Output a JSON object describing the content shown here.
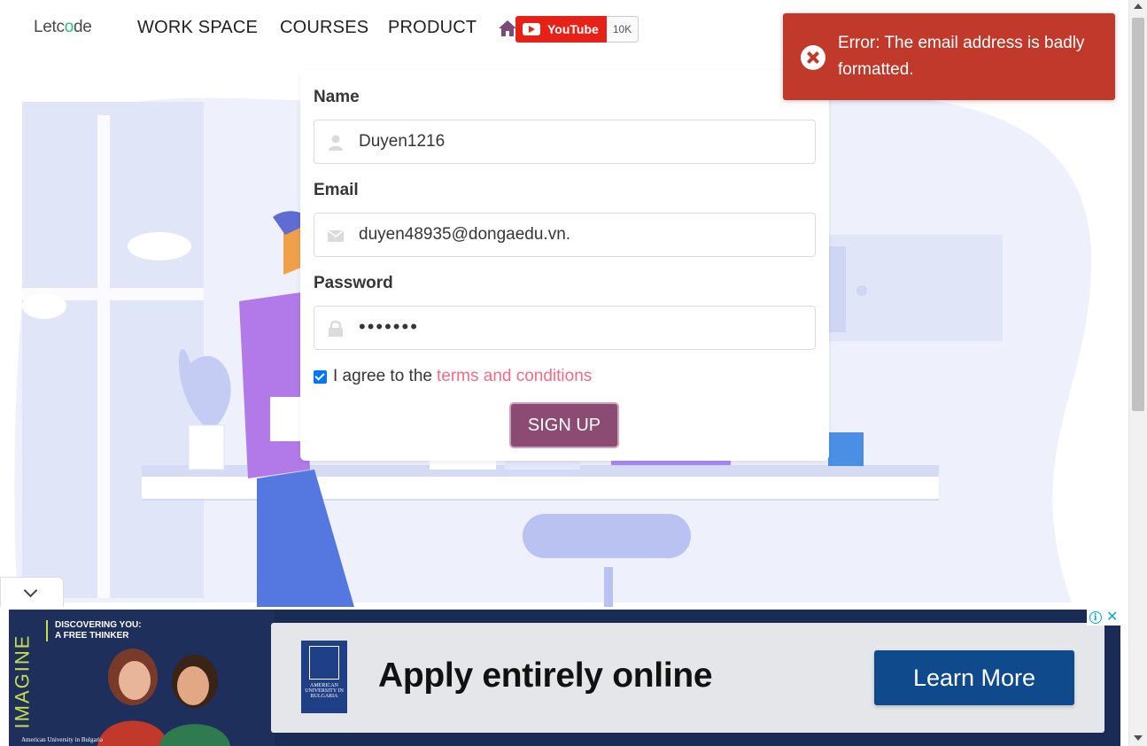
{
  "nav": {
    "logo_prefix": "Letc",
    "logo_o": "o",
    "logo_suffix": "de",
    "items": [
      "WORK SPACE",
      "COURSES",
      "PRODUCT"
    ],
    "youtube_label": "YouTube",
    "youtube_count": "10K"
  },
  "form": {
    "name_label": "Name",
    "name_value": "Duyen1216",
    "email_label": "Email",
    "email_value": "duyen48935@dongaedu.vn.",
    "password_label": "Password",
    "password_value": "•••••••",
    "agree_text": "I agree to the",
    "terms_link": "terms and conditions",
    "agree_checked": true,
    "signup_label": "SIGN UP"
  },
  "toast": {
    "message": "Error: The email address is badly formatted."
  },
  "ad": {
    "imagine": "IMAGINE",
    "tagline_line1": "DISCOVERING YOU:",
    "tagline_line2": "A FREE THINKER",
    "aub_small": "American University in Bulgaria",
    "logo_text": "AMERICAN UNIVERSITY IN BULGARIA",
    "headline": "Apply entirely online",
    "cta": "Learn More"
  },
  "colors": {
    "accent_button": "#8c4b72",
    "error_toast": "#c0392b",
    "terms_link": "#f14668",
    "youtube_red": "#e62117",
    "ad_cta": "#0f4a8c"
  },
  "icons": [
    "home-icon",
    "user-icon",
    "envelope-icon",
    "lock-icon",
    "error-circle-icon",
    "chevron-down-icon",
    "info-icon",
    "close-icon",
    "play-icon"
  ]
}
